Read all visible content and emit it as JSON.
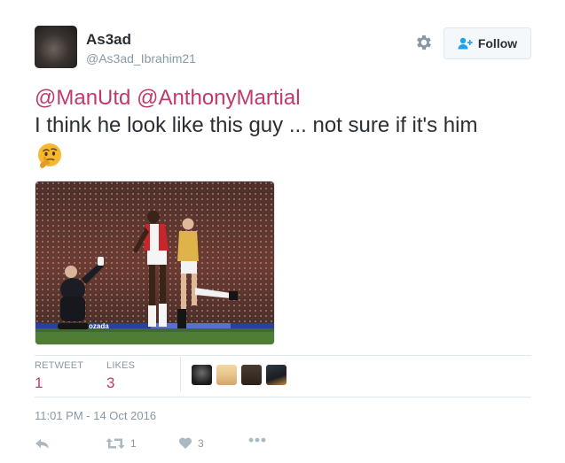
{
  "user": {
    "name": "As3ad",
    "handle": "@As3ad_Ibrahim21"
  },
  "follow_button": {
    "label": "Follow"
  },
  "tweet": {
    "mentions": [
      "@ManUtd",
      "@AnthonyMartial"
    ],
    "body": "I think he look like this guy ... not sure if it's him",
    "emoji": "thinking-face-icon"
  },
  "stats": {
    "retweets_label": "RETWEET",
    "retweets_count": "1",
    "likes_label": "LIKES",
    "likes_count": "3"
  },
  "timestamp": "11:01 PM - 14 Oct 2016",
  "actions": {
    "retweet_count": "1",
    "like_count": "3"
  },
  "colors": {
    "accent": "#c0396b",
    "muted": "#8899a6",
    "text": "#292f33",
    "border": "#e1e8ed"
  }
}
